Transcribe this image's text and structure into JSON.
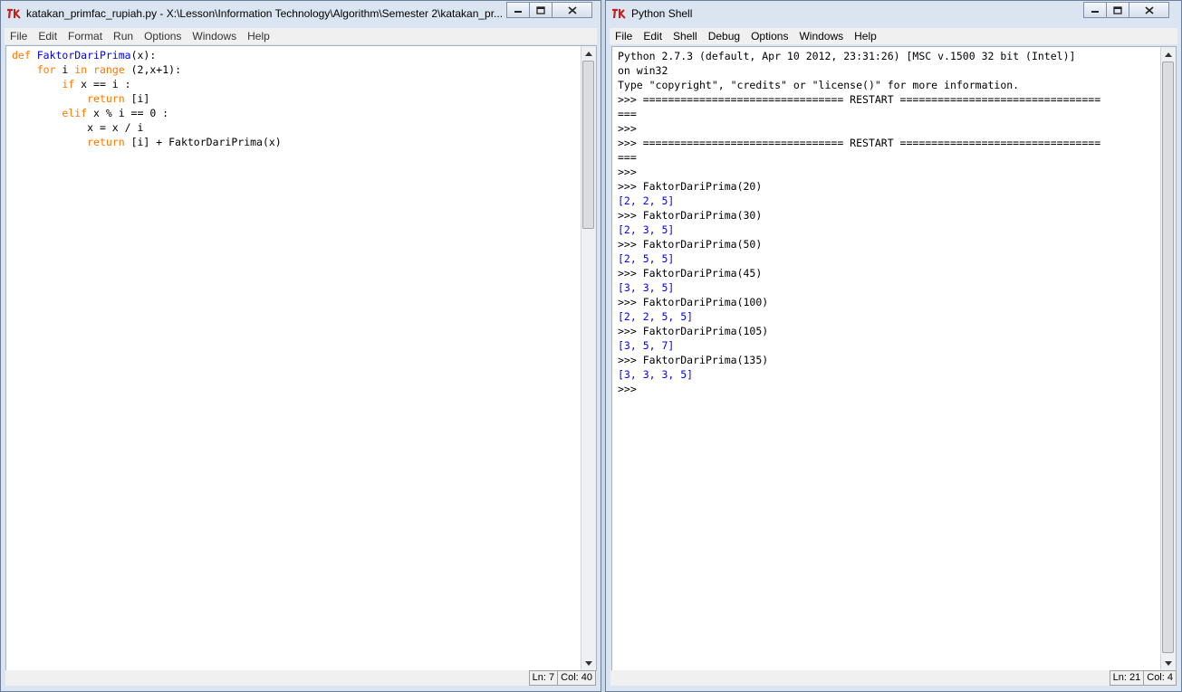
{
  "editor": {
    "title": "katakan_primfac_rupiah.py - X:\\Lesson\\Information Technology\\Algorithm\\Semester 2\\katakan_pr...",
    "menu": [
      "File",
      "Edit",
      "Format",
      "Run",
      "Options",
      "Windows",
      "Help"
    ],
    "status": {
      "ln": "Ln: 7",
      "col": "Col: 40"
    }
  },
  "shell": {
    "title": "Python Shell",
    "menu": [
      "File",
      "Edit",
      "Shell",
      "Debug",
      "Options",
      "Windows",
      "Help"
    ],
    "header": [
      "Python 2.7.3 (default, Apr 10 2012, 23:31:26) [MSC v.1500 32 bit (Intel)]",
      "on win32",
      "Type \"copyright\", \"credits\" or \"license()\" for more information."
    ],
    "restart_line_1": ">>> ================================ RESTART ================================",
    "restart_line_2": "===",
    "prompt": ">>>",
    "calls": [
      {
        "cmd": "FaktorDariPrima(20)",
        "out": "[2, 2, 5]"
      },
      {
        "cmd": "FaktorDariPrima(30)",
        "out": "[2, 3, 5]"
      },
      {
        "cmd": "FaktorDariPrima(50)",
        "out": "[2, 5, 5]"
      },
      {
        "cmd": "FaktorDariPrima(45)",
        "out": "[3, 3, 5]"
      },
      {
        "cmd": "FaktorDariPrima(100)",
        "out": "[2, 2, 5, 5]"
      },
      {
        "cmd": "FaktorDariPrima(105)",
        "out": "[3, 5, 7]"
      },
      {
        "cmd": "FaktorDariPrima(135)",
        "out": "[3, 3, 3, 5]"
      }
    ],
    "status": {
      "ln": "Ln: 21",
      "col": "Col: 4"
    }
  },
  "code": {
    "kw_def": "def",
    "fname": "FaktorDariPrima",
    "sig": "(x):",
    "kw_for": "for",
    "loop_var": " i ",
    "kw_in": "in",
    "kw_range": "range",
    "range_args": " (2,x+1):",
    "kw_if": "if",
    "if_cond": " x == i :",
    "kw_return": "return",
    "ret1": " [i]",
    "kw_elif": "elif",
    "elif_cond": " x % i == 0 :",
    "assign": "x = x / i",
    "ret2": " [i] + FaktorDariPrima(x)"
  }
}
